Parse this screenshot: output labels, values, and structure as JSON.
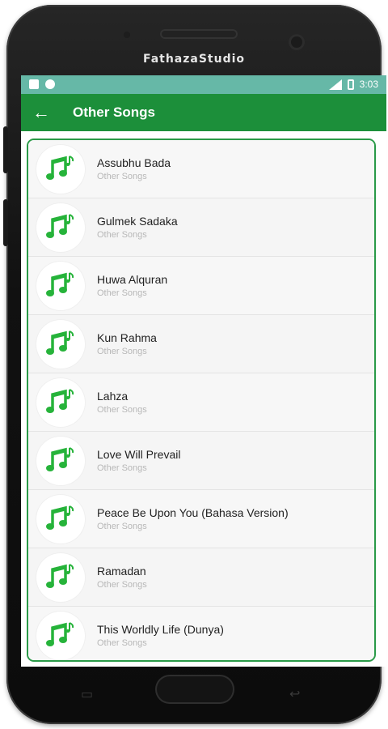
{
  "device": {
    "brand": "FathazaStudio"
  },
  "status_bar": {
    "time": "3:03"
  },
  "app_bar": {
    "title": "Other Songs"
  },
  "songs": [
    {
      "title": "Assubhu Bada",
      "subtitle": "Other Songs"
    },
    {
      "title": "Gulmek Sadaka",
      "subtitle": "Other Songs"
    },
    {
      "title": "Huwa Alquran",
      "subtitle": "Other Songs"
    },
    {
      "title": "Kun Rahma",
      "subtitle": "Other Songs"
    },
    {
      "title": "Lahza",
      "subtitle": "Other Songs"
    },
    {
      "title": "Love Will Prevail",
      "subtitle": "Other Songs"
    },
    {
      "title": "Peace Be Upon You (Bahasa Version)",
      "subtitle": "Other Songs"
    },
    {
      "title": "Ramadan",
      "subtitle": "Other Songs"
    },
    {
      "title": "This Worldly Life (Dunya)",
      "subtitle": "Other Songs"
    }
  ],
  "colors": {
    "status_bar": "#66b8a7",
    "app_bar": "#1c8f3a",
    "card_border": "#2a9a48",
    "note_icon": "#26b33a"
  },
  "icons": {
    "back": "arrow-left-icon",
    "song": "music-note-icon"
  }
}
